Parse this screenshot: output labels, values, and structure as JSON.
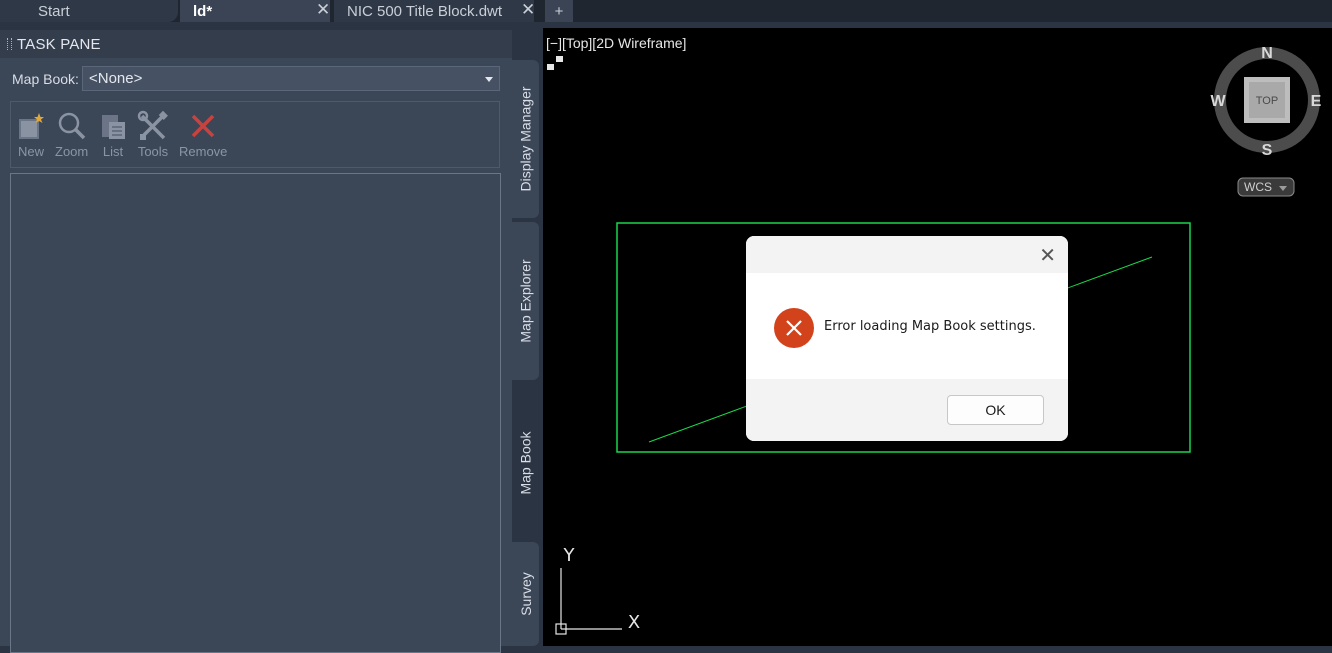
{
  "tabs": [
    {
      "label": "Start"
    },
    {
      "label": "ld*",
      "close": "✕"
    },
    {
      "label": "NIC 500 Title Block.dwt",
      "close": "✕"
    }
  ],
  "add_tab": "+",
  "task_pane": {
    "title": "TASK PANE",
    "map_book_label": "Map Book:",
    "map_book_value": "<None>",
    "tools": [
      {
        "label": "New",
        "icon": "new-book-icon"
      },
      {
        "label": "Zoom",
        "icon": "magnifier-icon"
      },
      {
        "label": "List",
        "icon": "list-icon"
      },
      {
        "label": "Tools",
        "icon": "wrench-screwdriver-icon"
      },
      {
        "label": "Remove",
        "icon": "red-x-icon"
      }
    ],
    "side_tabs": [
      "Display Manager",
      "Map Explorer",
      "Map Book",
      "Survey"
    ]
  },
  "viewport": {
    "label": "[−][Top][2D Wireframe]",
    "viewcube": {
      "n": "N",
      "s": "S",
      "e": "E",
      "w": "W",
      "face": "TOP"
    },
    "ucs_label": "WCS",
    "axis_x": "X",
    "axis_y": "Y",
    "line_color": "#1bd64a"
  },
  "dialog": {
    "message": "Error loading Map Book settings.",
    "ok_label": "OK",
    "close": "✕",
    "icon_color": "#d2431b"
  }
}
